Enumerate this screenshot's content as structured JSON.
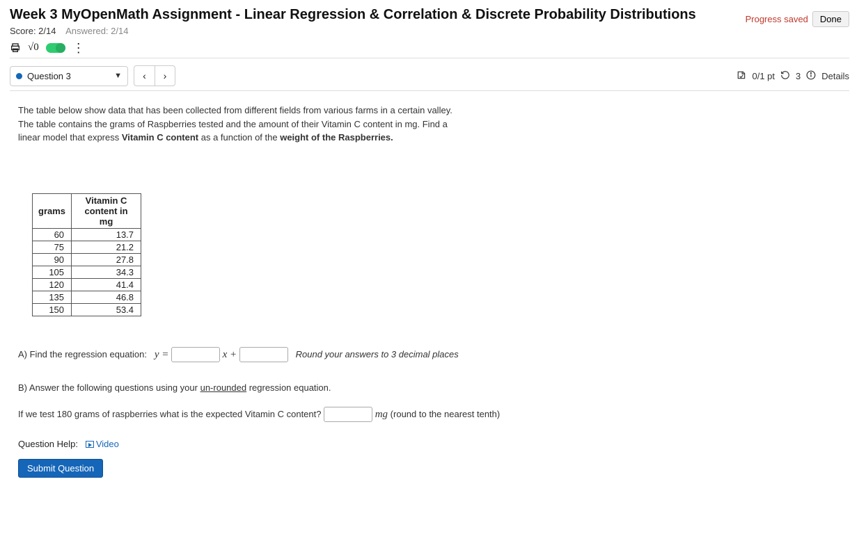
{
  "header": {
    "title": "Week 3 MyOpenMath Assignment - Linear Regression & Correlation & Discrete Probability Distributions",
    "score_label": "Score: 2/14",
    "answered_label": "Answered: 2/14",
    "progress_saved": "Progress saved",
    "done": "Done"
  },
  "question_bar": {
    "selected": "Question 3",
    "points": "0/1 pt",
    "retries": "3",
    "details": "Details"
  },
  "prompt": {
    "text_1": "The table below show data that has been collected from different fields from various farms in a certain valley. The table contains the grams of Raspberries tested and the amount of their Vitamin C content in mg. Find a linear model that express ",
    "bold_1": "Vitamin C content",
    "text_2": " as a function of the ",
    "bold_2": "weight of the Raspberries.",
    "text_3": ""
  },
  "table": {
    "col1": "grams",
    "col2": "Vitamin C content in mg",
    "rows": [
      {
        "g": "60",
        "v": "13.7"
      },
      {
        "g": "75",
        "v": "21.2"
      },
      {
        "g": "90",
        "v": "27.8"
      },
      {
        "g": "105",
        "v": "34.3"
      },
      {
        "g": "120",
        "v": "41.4"
      },
      {
        "g": "135",
        "v": "46.8"
      },
      {
        "g": "150",
        "v": "53.4"
      }
    ]
  },
  "part_a": {
    "label": "A)  Find the regression equation:",
    "y_eq": "y =",
    "x_plus": "x +",
    "note": "Round your answers to 3 decimal places"
  },
  "part_b": {
    "label": "B)  Answer the following questions using your ",
    "underlined": "un-rounded",
    "label_2": " regression equation.",
    "q1_a": "If we test 180 grams of raspberries what is the expected Vitamin C content? ",
    "unit": "mg",
    "q1_b": " (round to the nearest tenth)"
  },
  "help": {
    "label": "Question Help:",
    "video": "Video"
  },
  "submit": "Submit Question"
}
